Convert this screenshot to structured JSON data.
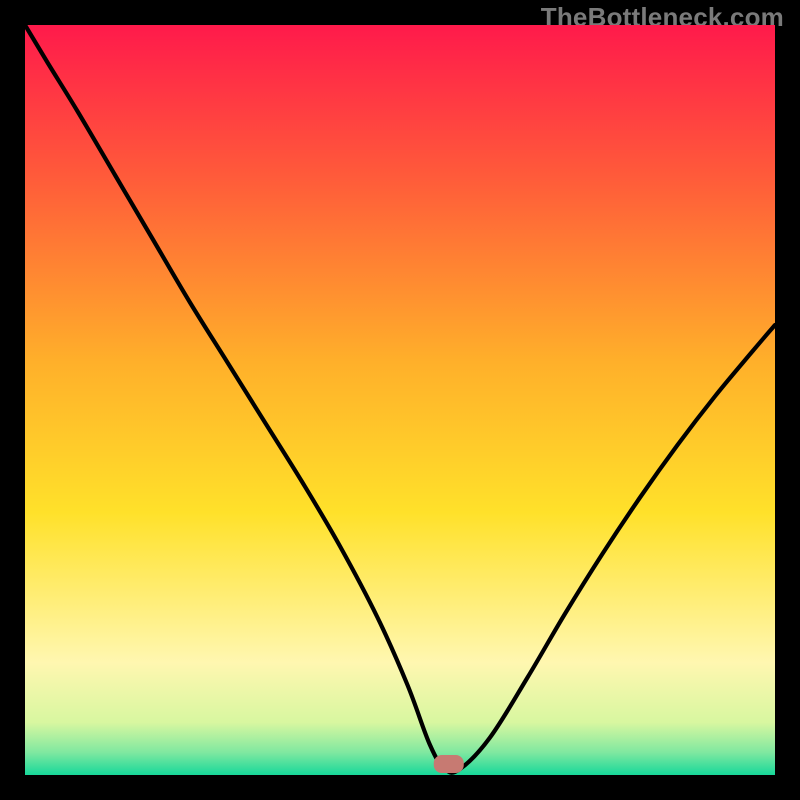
{
  "watermark": "TheBottleneck.com",
  "colors": {
    "page_bg": "#000000",
    "curve": "#000000",
    "marker": "#c77a72",
    "gradient": [
      {
        "offset": "0%",
        "color": "#ff1a4b"
      },
      {
        "offset": "20%",
        "color": "#ff5a3a"
      },
      {
        "offset": "45%",
        "color": "#ffb02a"
      },
      {
        "offset": "65%",
        "color": "#ffe12a"
      },
      {
        "offset": "85%",
        "color": "#fff7b0"
      },
      {
        "offset": "93%",
        "color": "#d8f7a0"
      },
      {
        "offset": "97%",
        "color": "#7fe8a0"
      },
      {
        "offset": "100%",
        "color": "#17d89a"
      }
    ]
  },
  "chart_data": {
    "type": "line",
    "title": "",
    "xlabel": "",
    "ylabel": "",
    "xlim": [
      0,
      100
    ],
    "ylim": [
      0,
      100
    ],
    "optimum_x": 56,
    "marker": {
      "x": 54.5,
      "y": 0,
      "w": 4,
      "h": 2.4
    },
    "series": [
      {
        "name": "bottleneck-curve",
        "x": [
          0,
          3,
          7,
          12,
          17,
          22,
          27,
          32,
          37,
          42,
          47,
          51,
          54,
          56,
          58,
          62,
          67,
          72,
          77,
          82,
          87,
          92,
          97,
          100
        ],
        "y": [
          100,
          95,
          88.5,
          80,
          71.5,
          63,
          55,
          47,
          39,
          30.5,
          21,
          12,
          4,
          0.8,
          0.8,
          5,
          13,
          21.5,
          29.5,
          37,
          44,
          50.5,
          56.5,
          60
        ]
      }
    ]
  }
}
